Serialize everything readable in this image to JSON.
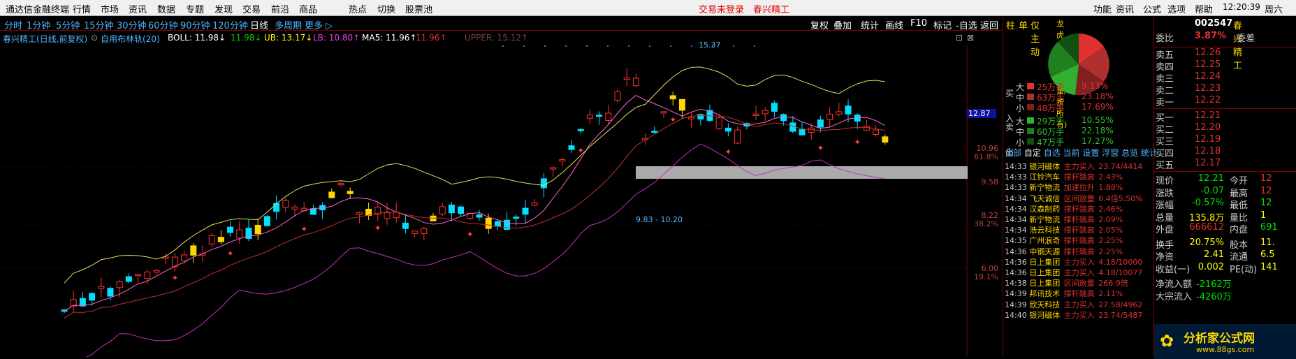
{
  "app_title": "通达信金融终端",
  "menu": [
    "行情",
    "市场",
    "资讯",
    "数据",
    "专题",
    "发现",
    "交易",
    "前沿",
    "商品",
    "热点",
    "切换",
    "股票池"
  ],
  "status_center": [
    "交易未登录",
    "春兴精工"
  ],
  "menu_right": [
    "功能",
    "资讯",
    "公式",
    "选项",
    "帮助"
  ],
  "clock": "12:20:39",
  "weekday": "周六",
  "periods": [
    "分时",
    "1分钟",
    "5分钟",
    "15分钟",
    "30分钟",
    "60分钟",
    "90分钟",
    "120分钟",
    "日线",
    "多周期",
    "更多 ▷"
  ],
  "active_period": "日线",
  "tools": [
    "复权",
    "叠加",
    "统计",
    "画线",
    "F10",
    "标记"
  ],
  "tools2": [
    "-自选",
    "返回"
  ],
  "side_tabs": [
    "柱",
    "单",
    "仅主动",
    "龙虎看盘(成交量/按所有)"
  ],
  "indicator": {
    "stock": "春兴精工(日线,前复权)",
    "formula": "自用布林轨(20)",
    "boll": "BOLL: 11.98↓",
    "mid": "11.98↓",
    "ub": "UB: 13.17↓",
    "lb": "LB: 10.80↑",
    "ma5": "MA5: 11.96↑",
    "ma5b": "11.96↑",
    "upper": "UPPER: 15.12↑"
  },
  "chart_labels": {
    "high": "15.37",
    "range": "9.83 - 10.20",
    "right_price": "12.87"
  },
  "y_axis": [
    {
      "v": "10.96",
      "c": "#c04040"
    },
    {
      "v": "61.8%",
      "c": "#c04040"
    },
    {
      "v": "9.58",
      "c": "#c04040"
    },
    {
      "v": "8.22",
      "c": "#c04040"
    },
    {
      "v": "38.2%",
      "c": "#c04040"
    },
    {
      "v": "6.00",
      "c": "#c04040"
    },
    {
      "v": "19.1%",
      "c": "#c04040"
    }
  ],
  "flow": {
    "buy_label": [
      "买",
      "入"
    ],
    "sell_label": [
      "卖",
      "出"
    ],
    "rows": [
      {
        "size": "大",
        "vol": "25万手",
        "pct": "9.13%",
        "c": "#e03030"
      },
      {
        "size": "中",
        "vol": "63万手",
        "pct": "23.18%",
        "c": "#b03030"
      },
      {
        "size": "小",
        "vol": "48万手",
        "pct": "17.69%",
        "c": "#802020"
      },
      {
        "size": "大",
        "vol": "29万手",
        "pct": "10.55%",
        "c": "#30b030"
      },
      {
        "size": "中",
        "vol": "60万手",
        "pct": "22.18%",
        "c": "#208020"
      },
      {
        "size": "小",
        "vol": "47万手",
        "pct": "17.27%",
        "c": "#105010"
      }
    ]
  },
  "tabs_small": [
    "全部",
    "自定",
    "自选",
    "当前",
    "设置",
    "浮窗",
    "总览",
    "统计"
  ],
  "ticker": [
    {
      "t": "14:33",
      "n": "银河磁体",
      "e": "主力买入",
      "v": "23.74/4414"
    },
    {
      "t": "14:33",
      "n": "江铃汽车",
      "e": "撑杆跳高",
      "v": "2.43%"
    },
    {
      "t": "14:33",
      "n": "新宁物流",
      "e": "加速拉升",
      "v": "1.88%"
    },
    {
      "t": "14:34",
      "n": "飞天诚信",
      "e": "区间放量",
      "v": "6.4倍5.50%"
    },
    {
      "t": "14:34",
      "n": "汉森制药",
      "e": "撑杆跳高",
      "v": "2.46%"
    },
    {
      "t": "14:34",
      "n": "新宁物流",
      "e": "撑杆跳高",
      "v": "2.09%"
    },
    {
      "t": "14:34",
      "n": "浩云科技",
      "e": "撑杆跳高",
      "v": "2.05%"
    },
    {
      "t": "14:35",
      "n": "广州浪奇",
      "e": "撑杆跳高",
      "v": "2.25%"
    },
    {
      "t": "14:36",
      "n": "中钢天源",
      "e": "撑杆跳高",
      "v": "2.25%"
    },
    {
      "t": "14:36",
      "n": "日上集团",
      "e": "主力买入",
      "v": "4.18/10000"
    },
    {
      "t": "14:36",
      "n": "日上集团",
      "e": "主力买入",
      "v": "4.18/10077"
    },
    {
      "t": "14:38",
      "n": "日上集团",
      "e": "区间放量",
      "v": "266.9倍"
    },
    {
      "t": "14:39",
      "n": "邦讯技术",
      "e": "撑杆跳高",
      "v": "2.11%"
    },
    {
      "t": "14:39",
      "n": "欣天科技",
      "e": "主力买入",
      "v": "27.58/4962"
    },
    {
      "t": "14:40",
      "n": "银河磁体",
      "e": "主力买入",
      "v": "23.74/5487"
    }
  ],
  "quote": {
    "code": "002547",
    "name": "春兴精工",
    "webi_label": "委比",
    "webi": "3.87%",
    "weicha": "委差",
    "sells": [
      {
        "l": "卖五",
        "p": "12.26"
      },
      {
        "l": "卖四",
        "p": "12.25"
      },
      {
        "l": "卖三",
        "p": "12.24"
      },
      {
        "l": "卖二",
        "p": "12.23"
      },
      {
        "l": "卖一",
        "p": "12.22"
      }
    ],
    "buys": [
      {
        "l": "买一",
        "p": "12.21"
      },
      {
        "l": "买二",
        "p": "12.20"
      },
      {
        "l": "买三",
        "p": "12.19"
      },
      {
        "l": "买四",
        "p": "12.18"
      },
      {
        "l": "买五",
        "p": "12.17"
      }
    ],
    "stats": [
      {
        "a": "现价",
        "av": "12.21",
        "ac": "#00e000",
        "b": "今开",
        "bv": "12",
        "bc": "#e03030"
      },
      {
        "a": "涨跌",
        "av": "-0.07",
        "ac": "#00e000",
        "b": "最高",
        "bv": "12",
        "bc": "#e03030"
      },
      {
        "a": "涨幅",
        "av": "-0.57%",
        "ac": "#00e000",
        "b": "最低",
        "bv": "12",
        "bc": "#00e000"
      },
      {
        "a": "总量",
        "av": "135.8万",
        "ac": "#ffff00",
        "b": "量比",
        "bv": "1",
        "bc": "#ffff00"
      },
      {
        "a": "外盘",
        "av": "666612",
        "ac": "#e03030",
        "b": "内盘",
        "bv": "691",
        "bc": "#00e000"
      },
      {
        "a": "换手",
        "av": "20.75%",
        "ac": "#ffff00",
        "b": "股本",
        "bv": "11.",
        "bc": "#ffff00"
      },
      {
        "a": "净资",
        "av": "2.41",
        "ac": "#ffff00",
        "b": "流通",
        "bv": "6.5",
        "bc": "#ffff00"
      },
      {
        "a": "收益(一)",
        "av": "0.002",
        "ac": "#ffff00",
        "b": "PE(动)",
        "bv": "141",
        "bc": "#ffff00"
      },
      {
        "a": "净流入额",
        "av": "-2162万",
        "ac": "#00e000",
        "b": "",
        "bv": "",
        "bc": "#fff"
      },
      {
        "a": "大宗流入",
        "av": "-4260万",
        "ac": "#00e000",
        "b": "",
        "bv": "",
        "bc": "#fff"
      }
    ]
  },
  "watermark": {
    "site": "分析家公式网",
    "url": "www.88gs.com"
  }
}
